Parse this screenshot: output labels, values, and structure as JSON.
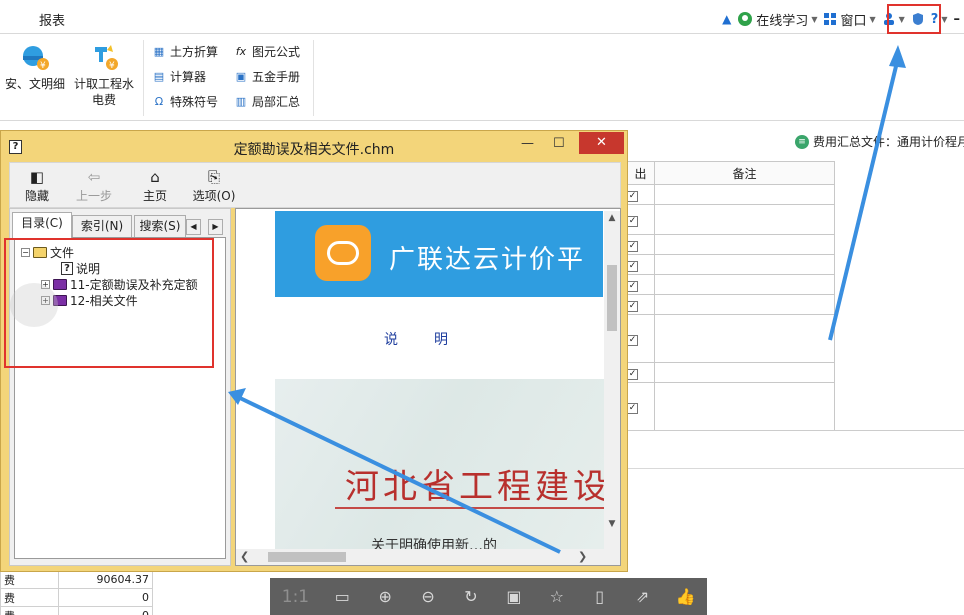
{
  "menubar": {
    "report_label": "报表",
    "online_learning_label": "在线学习",
    "window_label": "窗口",
    "help_symbol": "?"
  },
  "ribbon": {
    "big_buttons": [
      {
        "label_line1": "安、文明细",
        "label_line2": ""
      },
      {
        "label_line1": "计取工程水",
        "label_line2": "电费"
      }
    ],
    "tools_col1": [
      "土方折算",
      "计算器",
      "特殊符号"
    ],
    "tools_col2": [
      "图元公式",
      "五金手册",
      "局部汇总"
    ]
  },
  "workspace": {
    "cost_summary_label": "费用汇总文件：通用计价程月",
    "table_headers": [
      "出",
      "备注"
    ],
    "fee_rows": [
      {
        "name": "费",
        "value": "90604.37"
      },
      {
        "name": "费",
        "value": "0"
      },
      {
        "name": "费",
        "value": "0"
      }
    ]
  },
  "chm": {
    "title": "定额勘误及相关文件.chm",
    "toolbar": {
      "hide": "隐藏",
      "back": "上一步",
      "home": "主页",
      "options": "选项(O)"
    },
    "tabs": {
      "contents": "目录(C)",
      "index": "索引(N)",
      "search": "搜索(S)"
    },
    "tree": {
      "root": "文件",
      "item_intro": "说明",
      "item_errata": "11-定额勘误及补充定额",
      "item_related": "12-相关文件"
    },
    "content": {
      "banner_title": "广联达云计价平",
      "heading": "说明",
      "photo_text": "河北省工程建设",
      "photo_subtext": "关于明确使用新…的"
    }
  },
  "viewer_toolbar": {
    "ratio_label": "1:1"
  },
  "colors": {
    "chm_frame": "#f3d57a",
    "annotation_red": "#e0332d",
    "banner_blue": "#2f9de0",
    "arrow_blue": "#3a8fe0"
  }
}
